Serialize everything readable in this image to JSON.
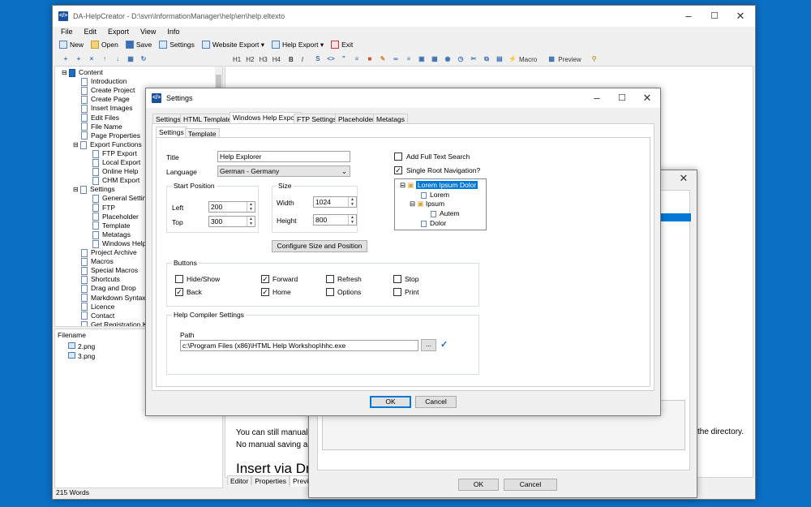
{
  "main": {
    "title": "DA-HelpCreator - D:\\svn\\InformationManager\\help\\en\\help.eltexto",
    "menu": [
      "File",
      "Edit",
      "Export",
      "View",
      "Info"
    ],
    "toolbar": [
      "New",
      "Open",
      "Save",
      "Settings",
      "Website Export",
      "Help Export",
      "Exit"
    ],
    "editor_toolbar": [
      "H1",
      "H2",
      "H3",
      "H4",
      "B",
      "I",
      "Macro",
      "Preview"
    ],
    "tree": [
      {
        "label": "Content",
        "level": 0
      },
      {
        "label": "Introduction",
        "level": 1
      },
      {
        "label": "Create Project",
        "level": 1
      },
      {
        "label": "Create Page",
        "level": 1
      },
      {
        "label": "Insert Images",
        "level": 1
      },
      {
        "label": "Edit Files",
        "level": 1
      },
      {
        "label": "File Name",
        "level": 1
      },
      {
        "label": "Page Properties",
        "level": 1
      },
      {
        "label": "Export Functions",
        "level": 1
      },
      {
        "label": "FTP Export",
        "level": 2
      },
      {
        "label": "Local Export",
        "level": 2
      },
      {
        "label": "Online Help",
        "level": 2
      },
      {
        "label": "CHM Export",
        "level": 2
      },
      {
        "label": "Settings",
        "level": 1
      },
      {
        "label": "General Settings",
        "level": 2
      },
      {
        "label": "FTP",
        "level": 2
      },
      {
        "label": "Placeholder",
        "level": 2
      },
      {
        "label": "Template",
        "level": 2
      },
      {
        "label": "Metatags",
        "level": 2
      },
      {
        "label": "Windows Help Ex",
        "level": 2
      },
      {
        "label": "Project Archive",
        "level": 1
      },
      {
        "label": "Macros",
        "level": 1
      },
      {
        "label": "Special Macros",
        "level": 1
      },
      {
        "label": "Shortcuts",
        "level": 1
      },
      {
        "label": "Drag and Drop",
        "level": 1
      },
      {
        "label": "Markdown Syntax",
        "level": 1
      },
      {
        "label": "Licence",
        "level": 1
      },
      {
        "label": "Contact",
        "level": 1
      },
      {
        "label": "Get Registration Key",
        "level": 1
      }
    ],
    "files_header": "Filename",
    "files": [
      "2.png",
      "3.png"
    ],
    "editor_text1": "You can still manuall",
    "editor_text2": "No manual saving ar",
    "editor_heading": "Insert via Dr",
    "editor_tabs": [
      "Editor",
      "Properties",
      "Preview"
    ],
    "status": "215 Words"
  },
  "back_dialog": {
    "text_right": "the directory.",
    "ok": "OK",
    "cancel": "Cancel"
  },
  "settings": {
    "title": "Settings",
    "tabs": [
      "Settings",
      "HTML Template",
      "Windows Help Export",
      "FTP Settings",
      "Placeholder",
      "Metatags"
    ],
    "subtabs": [
      "Settings",
      "Template"
    ],
    "title_label": "Title",
    "title_value": "Help Explorer",
    "language_label": "Language",
    "language_value": "German - Germany",
    "start_position": "Start Position",
    "left_label": "Left",
    "left_value": "200",
    "top_label": "Top",
    "top_value": "300",
    "size": "Size",
    "width_label": "Width",
    "width_value": "1024",
    "height_label": "Height",
    "height_value": "800",
    "configure": "Configure Size and Position",
    "fulltext": "Add Full Text Search",
    "singleroot": "Single Root Navigation?",
    "preview_tree": [
      "Lorem Ipsum Dolor",
      "Lorem",
      "Ipsum",
      "Autem",
      "Dolor"
    ],
    "buttons_group": "Buttons",
    "buttons": [
      {
        "label": "Hide/Show",
        "checked": false
      },
      {
        "label": "Forward",
        "checked": true
      },
      {
        "label": "Refresh",
        "checked": false
      },
      {
        "label": "Stop",
        "checked": false
      },
      {
        "label": "Back",
        "checked": true
      },
      {
        "label": "Home",
        "checked": true
      },
      {
        "label": "Options",
        "checked": false
      },
      {
        "label": "Print",
        "checked": false
      }
    ],
    "compiler_group": "Help Compiler Settings",
    "path_label": "Path",
    "path_value": "c:\\Program Files (x86)\\HTML Help Workshop\\hhc.exe",
    "browse": "...",
    "ok": "OK",
    "cancel": "Cancel"
  },
  "colors": {
    "desktop": "#0b6fc4",
    "selection": "#0078d7",
    "check": "#1a6fc4"
  }
}
